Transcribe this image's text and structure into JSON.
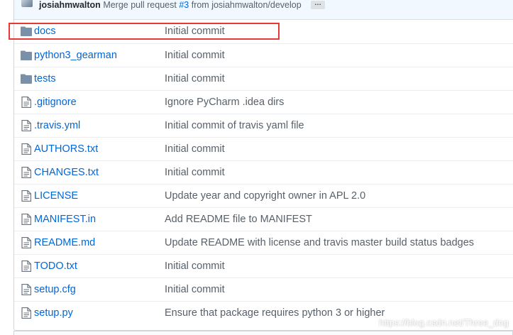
{
  "commit": {
    "author": "josiahmwalton",
    "message_prefix": "Merge pull request",
    "pr_link": "#3",
    "message_suffix": "from josiahmwalton/develop",
    "ellipsis": "…"
  },
  "files": [
    {
      "type": "folder",
      "icon": "folder-icon",
      "name": "docs",
      "message": "Initial commit"
    },
    {
      "type": "folder",
      "icon": "folder-icon",
      "name": "python3_gearman",
      "message": "Initial commit"
    },
    {
      "type": "folder",
      "icon": "folder-icon",
      "name": "tests",
      "message": "Initial commit"
    },
    {
      "type": "file",
      "icon": "file-icon",
      "name": ".gitignore",
      "message": "Ignore PyCharm .idea dirs"
    },
    {
      "type": "file",
      "icon": "file-icon",
      "name": ".travis.yml",
      "message": "Initial commit of travis yaml file"
    },
    {
      "type": "file",
      "icon": "file-icon",
      "name": "AUTHORS.txt",
      "message": "Initial commit"
    },
    {
      "type": "file",
      "icon": "file-icon",
      "name": "CHANGES.txt",
      "message": "Initial commit"
    },
    {
      "type": "file",
      "icon": "file-icon",
      "name": "LICENSE",
      "message": "Update year and copyright owner in APL 2.0"
    },
    {
      "type": "file",
      "icon": "file-icon",
      "name": "MANIFEST.in",
      "message": "Add README file to MANIFEST"
    },
    {
      "type": "file",
      "icon": "file-icon",
      "name": "README.md",
      "message": "Update README with license and travis master build status badges"
    },
    {
      "type": "file",
      "icon": "file-icon",
      "name": "TODO.txt",
      "message": "Initial commit"
    },
    {
      "type": "file",
      "icon": "file-icon",
      "name": "setup.cfg",
      "message": "Initial commit"
    },
    {
      "type": "file",
      "icon": "file-icon",
      "name": "setup.py",
      "message": "Ensure that package requires python 3 or higher"
    }
  ],
  "watermark": "https://blog.csdn.net/Three_dog",
  "colors": {
    "link": "#0366d6",
    "highlight": "#e53935",
    "folder": "#79b8ff",
    "commit_bar": "#f1f8ff"
  }
}
